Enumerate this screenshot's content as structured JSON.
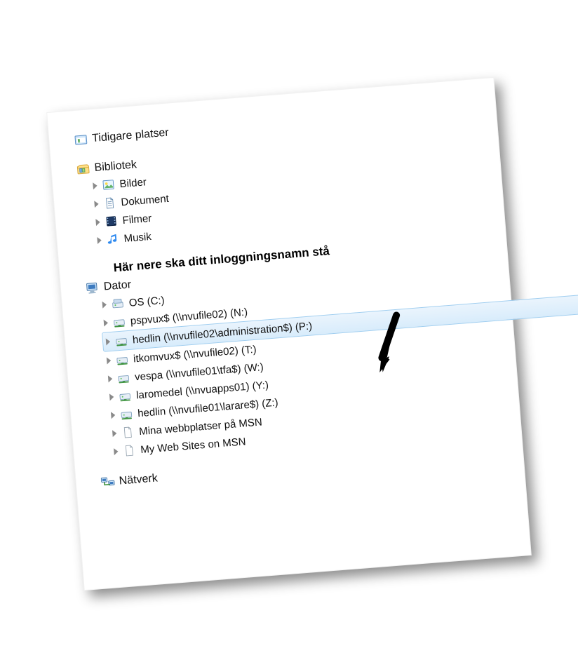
{
  "recent": {
    "label": "Tidigare platser"
  },
  "libraries": {
    "label": "Bibliotek",
    "items": [
      {
        "label": "Bilder",
        "icon": "picture"
      },
      {
        "label": "Dokument",
        "icon": "document"
      },
      {
        "label": "Filmer",
        "icon": "film"
      },
      {
        "label": "Musik",
        "icon": "music"
      }
    ]
  },
  "annotation": "Här nere ska ditt inloggningsnamn stå",
  "computer": {
    "label": "Dator",
    "drives": [
      {
        "label": "OS (C:)",
        "icon": "hdd",
        "selected": false
      },
      {
        "label": "pspvux$ (\\\\nvufile02) (N:)",
        "icon": "netdrive",
        "selected": false
      },
      {
        "label": "hedlin (\\\\nvufile02\\administration$) (P:)",
        "icon": "netdrive",
        "selected": true
      },
      {
        "label": "itkomvux$ (\\\\nvufile02) (T:)",
        "icon": "netdrive",
        "selected": false
      },
      {
        "label": "vespa (\\\\nvufile01\\tfa$) (W:)",
        "icon": "netdrive",
        "selected": false
      },
      {
        "label": "laromedel (\\\\nvuapps01) (Y:)",
        "icon": "netdrive",
        "selected": false
      },
      {
        "label": "hedlin (\\\\nvufile01\\larare$) (Z:)",
        "icon": "netdrive",
        "selected": false
      },
      {
        "label": "Mina webbplatser på MSN",
        "icon": "page",
        "selected": false
      },
      {
        "label": "My Web Sites on MSN",
        "icon": "page",
        "selected": false
      }
    ]
  },
  "network": {
    "label": "Nätverk"
  }
}
